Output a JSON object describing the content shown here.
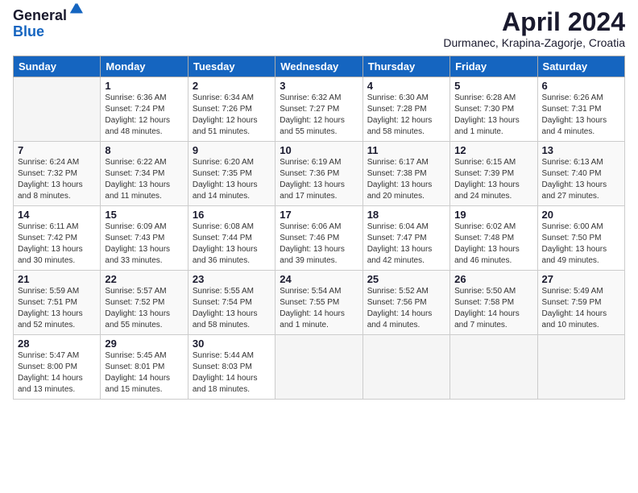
{
  "logo": {
    "general": "General",
    "blue": "Blue"
  },
  "header": {
    "title": "April 2024",
    "location": "Durmanec, Krapina-Zagorje, Croatia"
  },
  "days": [
    "Sunday",
    "Monday",
    "Tuesday",
    "Wednesday",
    "Thursday",
    "Friday",
    "Saturday"
  ],
  "weeks": [
    [
      {
        "date": "",
        "info": ""
      },
      {
        "date": "1",
        "info": "Sunrise: 6:36 AM\nSunset: 7:24 PM\nDaylight: 12 hours\nand 48 minutes."
      },
      {
        "date": "2",
        "info": "Sunrise: 6:34 AM\nSunset: 7:26 PM\nDaylight: 12 hours\nand 51 minutes."
      },
      {
        "date": "3",
        "info": "Sunrise: 6:32 AM\nSunset: 7:27 PM\nDaylight: 12 hours\nand 55 minutes."
      },
      {
        "date": "4",
        "info": "Sunrise: 6:30 AM\nSunset: 7:28 PM\nDaylight: 12 hours\nand 58 minutes."
      },
      {
        "date": "5",
        "info": "Sunrise: 6:28 AM\nSunset: 7:30 PM\nDaylight: 13 hours\nand 1 minute."
      },
      {
        "date": "6",
        "info": "Sunrise: 6:26 AM\nSunset: 7:31 PM\nDaylight: 13 hours\nand 4 minutes."
      }
    ],
    [
      {
        "date": "7",
        "info": "Sunrise: 6:24 AM\nSunset: 7:32 PM\nDaylight: 13 hours\nand 8 minutes."
      },
      {
        "date": "8",
        "info": "Sunrise: 6:22 AM\nSunset: 7:34 PM\nDaylight: 13 hours\nand 11 minutes."
      },
      {
        "date": "9",
        "info": "Sunrise: 6:20 AM\nSunset: 7:35 PM\nDaylight: 13 hours\nand 14 minutes."
      },
      {
        "date": "10",
        "info": "Sunrise: 6:19 AM\nSunset: 7:36 PM\nDaylight: 13 hours\nand 17 minutes."
      },
      {
        "date": "11",
        "info": "Sunrise: 6:17 AM\nSunset: 7:38 PM\nDaylight: 13 hours\nand 20 minutes."
      },
      {
        "date": "12",
        "info": "Sunrise: 6:15 AM\nSunset: 7:39 PM\nDaylight: 13 hours\nand 24 minutes."
      },
      {
        "date": "13",
        "info": "Sunrise: 6:13 AM\nSunset: 7:40 PM\nDaylight: 13 hours\nand 27 minutes."
      }
    ],
    [
      {
        "date": "14",
        "info": "Sunrise: 6:11 AM\nSunset: 7:42 PM\nDaylight: 13 hours\nand 30 minutes."
      },
      {
        "date": "15",
        "info": "Sunrise: 6:09 AM\nSunset: 7:43 PM\nDaylight: 13 hours\nand 33 minutes."
      },
      {
        "date": "16",
        "info": "Sunrise: 6:08 AM\nSunset: 7:44 PM\nDaylight: 13 hours\nand 36 minutes."
      },
      {
        "date": "17",
        "info": "Sunrise: 6:06 AM\nSunset: 7:46 PM\nDaylight: 13 hours\nand 39 minutes."
      },
      {
        "date": "18",
        "info": "Sunrise: 6:04 AM\nSunset: 7:47 PM\nDaylight: 13 hours\nand 42 minutes."
      },
      {
        "date": "19",
        "info": "Sunrise: 6:02 AM\nSunset: 7:48 PM\nDaylight: 13 hours\nand 46 minutes."
      },
      {
        "date": "20",
        "info": "Sunrise: 6:00 AM\nSunset: 7:50 PM\nDaylight: 13 hours\nand 49 minutes."
      }
    ],
    [
      {
        "date": "21",
        "info": "Sunrise: 5:59 AM\nSunset: 7:51 PM\nDaylight: 13 hours\nand 52 minutes."
      },
      {
        "date": "22",
        "info": "Sunrise: 5:57 AM\nSunset: 7:52 PM\nDaylight: 13 hours\nand 55 minutes."
      },
      {
        "date": "23",
        "info": "Sunrise: 5:55 AM\nSunset: 7:54 PM\nDaylight: 13 hours\nand 58 minutes."
      },
      {
        "date": "24",
        "info": "Sunrise: 5:54 AM\nSunset: 7:55 PM\nDaylight: 14 hours\nand 1 minute."
      },
      {
        "date": "25",
        "info": "Sunrise: 5:52 AM\nSunset: 7:56 PM\nDaylight: 14 hours\nand 4 minutes."
      },
      {
        "date": "26",
        "info": "Sunrise: 5:50 AM\nSunset: 7:58 PM\nDaylight: 14 hours\nand 7 minutes."
      },
      {
        "date": "27",
        "info": "Sunrise: 5:49 AM\nSunset: 7:59 PM\nDaylight: 14 hours\nand 10 minutes."
      }
    ],
    [
      {
        "date": "28",
        "info": "Sunrise: 5:47 AM\nSunset: 8:00 PM\nDaylight: 14 hours\nand 13 minutes."
      },
      {
        "date": "29",
        "info": "Sunrise: 5:45 AM\nSunset: 8:01 PM\nDaylight: 14 hours\nand 15 minutes."
      },
      {
        "date": "30",
        "info": "Sunrise: 5:44 AM\nSunset: 8:03 PM\nDaylight: 14 hours\nand 18 minutes."
      },
      {
        "date": "",
        "info": ""
      },
      {
        "date": "",
        "info": ""
      },
      {
        "date": "",
        "info": ""
      },
      {
        "date": "",
        "info": ""
      }
    ]
  ]
}
